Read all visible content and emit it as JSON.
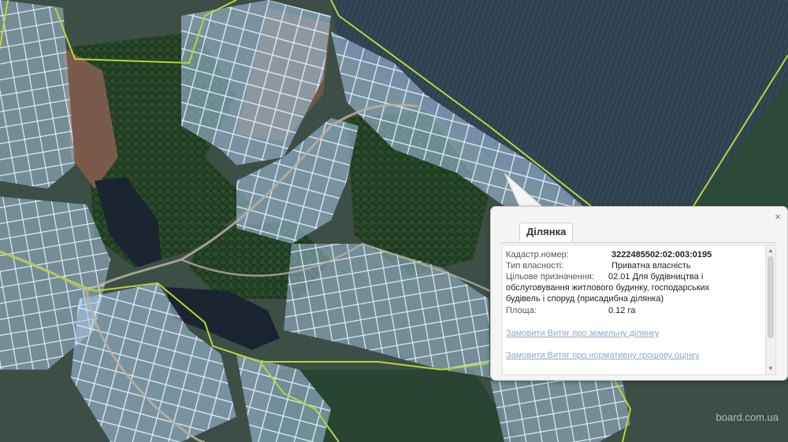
{
  "popup": {
    "tab_label": "Ділянка",
    "fields": [
      {
        "label": "Кадастр.номер:",
        "value": "3222485502:02:003:0195"
      },
      {
        "label": "Тип власності:",
        "value": "Приватна власність"
      },
      {
        "label": "Цільове призначення:",
        "value": "02.01 Для будівництва і"
      },
      {
        "label": "Площа:",
        "value": "0.12 га"
      }
    ],
    "purpose_continuation": [
      "обслуговування житлового будинку, господарських",
      "будівель і споруд (присадибна ділянка)"
    ],
    "links": [
      "Замовити Витяг про земельну ділянку",
      "Замовити Витяг про нормативну грошову оцінку"
    ],
    "close_symbol": "×"
  },
  "watermark": "board.com.ua",
  "colors": {
    "parcel_fill": "#a9c9e8",
    "parcel_stroke": "#dfeefa",
    "boundary": "#b8d636",
    "water": "#1a2530"
  }
}
